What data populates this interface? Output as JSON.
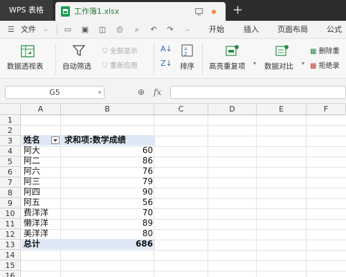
{
  "titlebar": {
    "app_tab": "WPS 表格",
    "document_tab": "工作簿1.xlsx",
    "new_tab_symbol": "+"
  },
  "menubar": {
    "file_menu": "文件",
    "tabs": [
      "开始",
      "插入",
      "页面布局",
      "公式"
    ]
  },
  "ribbon": {
    "pivot_table": "数据透视表",
    "auto_filter": "自动筛选",
    "show_all": "全部显示",
    "reapply": "重新应用",
    "sort": "排序",
    "highlight_duplicates": "高亮重复项",
    "data_compare": "数据对比",
    "remove_duplicates": "删除重",
    "reject_entry": "拒绝录"
  },
  "formula_bar": {
    "name_box": "G5",
    "fx_label": "fx",
    "value": ""
  },
  "sheet": {
    "columns": [
      "A",
      "B",
      "C",
      "D",
      "E",
      "F"
    ],
    "rows": [
      "1",
      "2",
      "3",
      "4",
      "5",
      "6",
      "7",
      "8",
      "9",
      "10",
      "11",
      "12",
      "13",
      "14",
      "15",
      "16"
    ],
    "pivot": {
      "row_header": "姓名",
      "value_header": "求和项:数学成绩",
      "entries": [
        {
          "name": "阿大",
          "score": "60"
        },
        {
          "name": "阿二",
          "score": "86"
        },
        {
          "name": "阿六",
          "score": "76"
        },
        {
          "name": "阿三",
          "score": "79"
        },
        {
          "name": "阿四",
          "score": "90"
        },
        {
          "name": "阿五",
          "score": "56"
        },
        {
          "name": "费洋洋",
          "score": "70"
        },
        {
          "name": "懒洋洋",
          "score": "89"
        },
        {
          "name": "美洋洋",
          "score": "80"
        }
      ],
      "total_label": "总计",
      "total_value": "686"
    }
  },
  "colors": {
    "titlebar_bg": "#2d2d2d",
    "doc_tab_text": "#2b7a3b",
    "pivot_header_bg": "#dde8f4"
  }
}
